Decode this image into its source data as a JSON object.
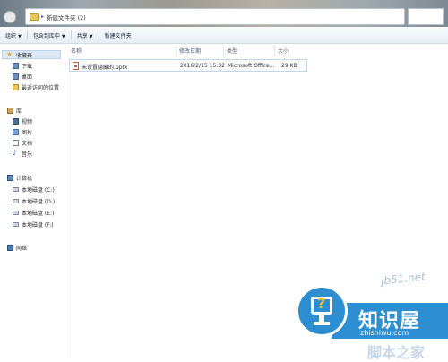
{
  "window": {
    "breadcrumb_arrow": "▸",
    "breadcrumb": "新建文件夹 (2)"
  },
  "toolbar": {
    "organize": "组织",
    "include_in_library": "包含到库中",
    "share": "共享",
    "new_folder": "新建文件夹",
    "caret": "▼"
  },
  "sidebar": {
    "favorites": "收藏夹",
    "favorites_items": [
      "下载",
      "桌面",
      "最近访问的位置"
    ],
    "libraries": "库",
    "libraries_items": [
      "视频",
      "图片",
      "文档",
      "音乐"
    ],
    "computer": "计算机",
    "computer_items": [
      "本地磁盘 (C:)",
      "本地磁盘 (D:)",
      "本地磁盘 (E:)",
      "本地磁盘 (F:)"
    ],
    "network": "网络"
  },
  "file_list": {
    "columns": [
      "名称",
      "修改日期",
      "类型",
      "大小"
    ],
    "rows": [
      {
        "name": "未设置隐藏的.pptx",
        "modified": "2016/2/15 15:32",
        "type": "Microsoft Office...",
        "size": "29 KB"
      }
    ]
  },
  "watermark": {
    "title": "知识屋",
    "subtitle": "zhishiwu.com",
    "faint_url": "jb51.net",
    "faint_text": "脚本之家"
  },
  "colors": {
    "selected_bg": "#dde9f6",
    "watermark_blue": "#2d8fd2",
    "watermark_accent": "#f2c12e"
  }
}
